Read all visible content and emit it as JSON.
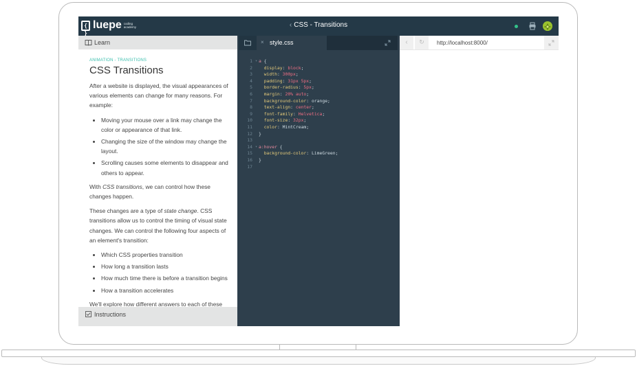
{
  "app": {
    "logo_mark": "{ }",
    "logo_name": "luepe",
    "logo_sub_1": "coding",
    "logo_sub_2": "academy",
    "title": "CSS - Transitions",
    "title_chevron": "‹",
    "status_color": "#33c28a"
  },
  "left_panel": {
    "learn_label": "Learn",
    "instructions_label": "Instructions",
    "kicker": "ANIMATION - TRANSITIONS",
    "heading": "CSS Transitions",
    "p1": "After a website is displayed, the visual appearances of various elements can change for many reasons. For example:",
    "list1": [
      "Moving your mouse over a link may change the color or appearance of that link.",
      "Changing the size of the window may change the layout.",
      "Scrolling causes some elements to disappear and others to appear."
    ],
    "p2_before": "With ",
    "p2_em": "CSS transitions",
    "p2_after": ", we can control how these changes happen.",
    "p3_before": "These changes are a type of ",
    "p3_em": "state change",
    "p3_after": ". CSS transitions allow us to control the timing of visual state changes. We can control the following four aspects of an element's transition:",
    "list2": [
      "Which CSS properties transition",
      "How long a transition lasts",
      "How much time there is before a transition begins",
      "How a transition accelerates"
    ],
    "p4": "We'll explore how different answers to each of these questions changes the animation. If any of these"
  },
  "editor": {
    "tab_close": "×",
    "file_name": "style.css",
    "lines": [
      {
        "n": "1",
        "fold": "▾",
        "parts": [
          [
            "sel",
            "a"
          ],
          [
            "plain",
            " {"
          ]
        ]
      },
      {
        "n": "2",
        "parts": [
          [
            "prop",
            "  display"
          ],
          [
            "plain",
            ": "
          ],
          [
            "val",
            "block"
          ],
          [
            "plain",
            ";"
          ]
        ]
      },
      {
        "n": "3",
        "parts": [
          [
            "prop",
            "  width"
          ],
          [
            "plain",
            ": "
          ],
          [
            "val",
            "300px"
          ],
          [
            "plain",
            ";"
          ]
        ]
      },
      {
        "n": "4",
        "parts": [
          [
            "prop",
            "  padding"
          ],
          [
            "plain",
            ": "
          ],
          [
            "val",
            "31px 5px"
          ],
          [
            "plain",
            ";"
          ]
        ]
      },
      {
        "n": "5",
        "parts": [
          [
            "prop",
            "  border-radius"
          ],
          [
            "plain",
            ": "
          ],
          [
            "val",
            "5px"
          ],
          [
            "plain",
            ";"
          ]
        ]
      },
      {
        "n": "6",
        "parts": [
          [
            "prop",
            "  margin"
          ],
          [
            "plain",
            ": "
          ],
          [
            "val",
            "20% auto"
          ],
          [
            "plain",
            ";"
          ]
        ]
      },
      {
        "n": "7",
        "parts": [
          [
            "prop",
            "  background-color"
          ],
          [
            "plain",
            ": orange;"
          ]
        ]
      },
      {
        "n": "8",
        "parts": [
          [
            "prop",
            "  text-align"
          ],
          [
            "plain",
            ": "
          ],
          [
            "val",
            "center"
          ],
          [
            "plain",
            ";"
          ]
        ]
      },
      {
        "n": "9",
        "parts": [
          [
            "prop",
            "  font-family"
          ],
          [
            "plain",
            ": "
          ],
          [
            "val",
            "Helvetica"
          ],
          [
            "plain",
            ";"
          ]
        ]
      },
      {
        "n": "10",
        "parts": [
          [
            "prop",
            "  font-size"
          ],
          [
            "plain",
            ": "
          ],
          [
            "val",
            "32px"
          ],
          [
            "plain",
            ";"
          ]
        ]
      },
      {
        "n": "11",
        "parts": [
          [
            "prop",
            "  color"
          ],
          [
            "plain",
            ": MintCream;"
          ]
        ]
      },
      {
        "n": "12",
        "parts": [
          [
            "plain",
            "}"
          ]
        ]
      },
      {
        "n": "13",
        "parts": []
      },
      {
        "n": "14",
        "fold": "▾",
        "parts": [
          [
            "sel",
            "a:hover"
          ],
          [
            "plain",
            " {"
          ]
        ]
      },
      {
        "n": "15",
        "parts": [
          [
            "prop",
            "  background-color"
          ],
          [
            "plain",
            ": LimeGreen;"
          ]
        ]
      },
      {
        "n": "16",
        "parts": [
          [
            "plain",
            "}"
          ]
        ]
      },
      {
        "n": "17",
        "parts": []
      }
    ]
  },
  "browser": {
    "back": "‹",
    "reload": "↻",
    "url": "http://localhost:8000/"
  }
}
